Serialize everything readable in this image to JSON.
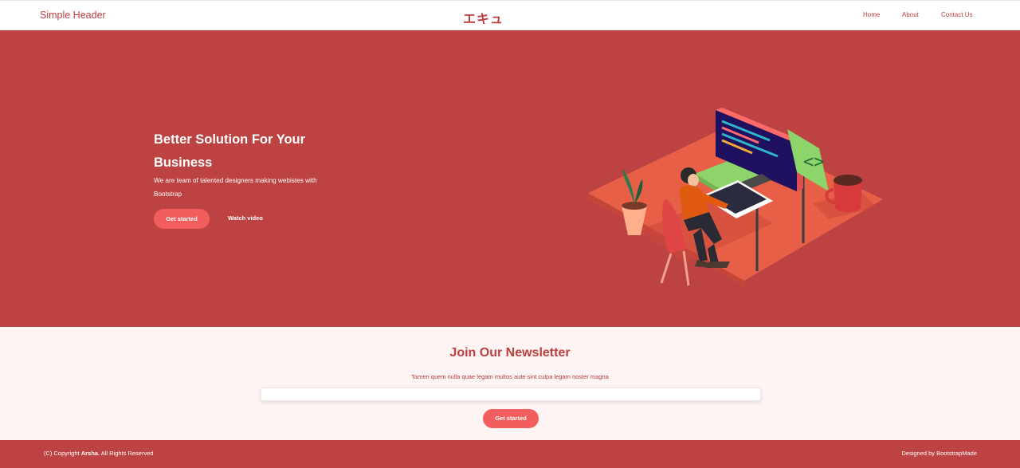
{
  "header": {
    "brand": "Simple Header",
    "logo_text": "エキュ",
    "nav": [
      "Home",
      "About",
      "Contact Us"
    ]
  },
  "hero": {
    "title": "Better Solution For Your Business",
    "subtitle": "We are team of talented designers making webistes with Bootstrap",
    "primary_button": "Get started",
    "secondary_link": "Watch video",
    "illustration_icon": "developer-at-desk-illustration"
  },
  "newsletter": {
    "title": "Join Our Newsletter",
    "text": "Tamen quem nulla quae legam multos aute sint culpa legam noster magna",
    "input_value": "",
    "button": "Get started"
  },
  "footer": {
    "copyright_prefix": "(C) Copyright",
    "copyright_brand": "Arsha.",
    "copyright_suffix": "All Rights Reserved",
    "designed_by": "Designed by BootstrapMade"
  },
  "colors": {
    "accent": "#bd4242",
    "button": "#f25e5e",
    "newsletter_bg": "#fdf4f3"
  }
}
